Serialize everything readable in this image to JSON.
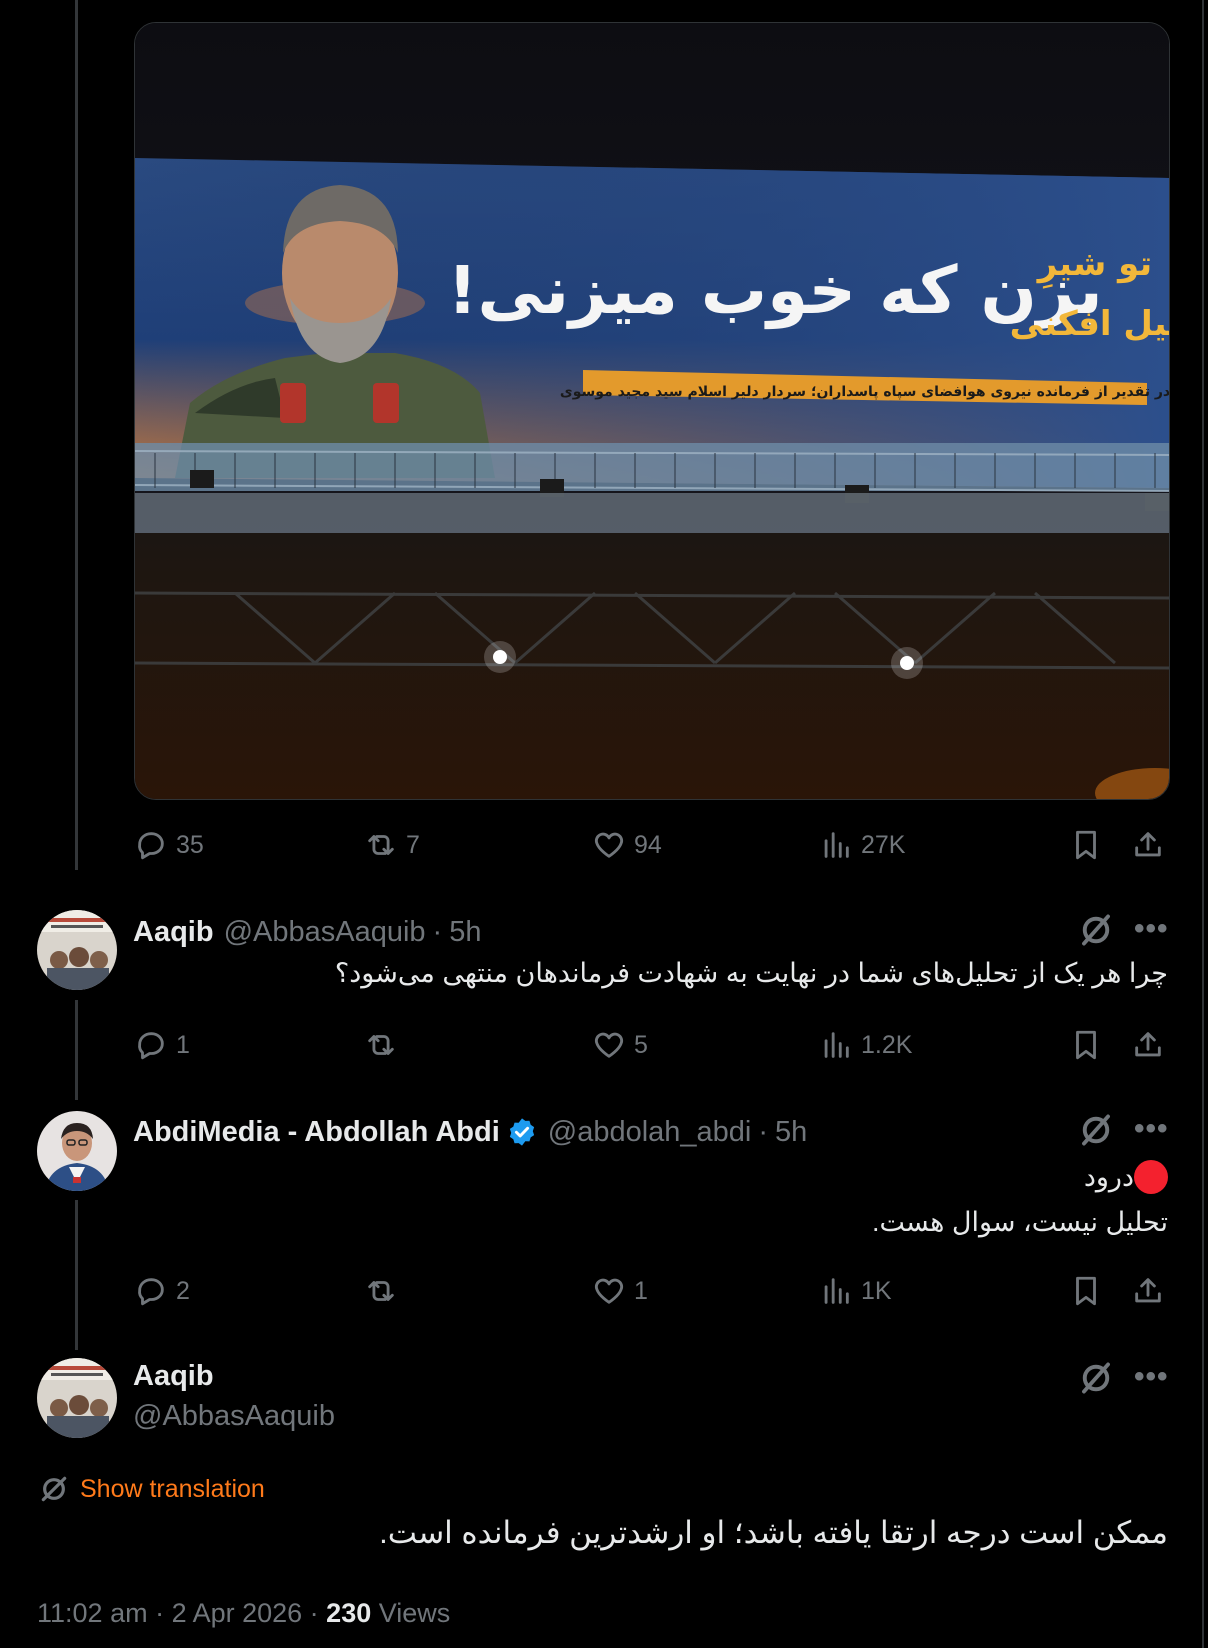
{
  "media": {
    "billboard_title": "بزن که خوب میزنی!",
    "billboard_side_1": "تو شیرِ",
    "billboard_side_2": "پیل افکنی",
    "billboard_banner": "در تقدیر از فرمانده نیروی هوافضای سپاه پاسداران؛ سردار دلیر اسلام سید مجید موسوی"
  },
  "main_stats": {
    "replies": "35",
    "reposts": "7",
    "likes": "94",
    "views": "27K"
  },
  "replies": [
    {
      "name": "Aaqib",
      "handle": "@AbbasAaquib",
      "time": "5h",
      "text": "چرا هر یک از تحلیل‌های شما در نهایت به شهادت فرماندهان منتهی می‌شود؟",
      "stats": {
        "replies": "1",
        "reposts": "",
        "likes": "5",
        "views": "1.2K"
      }
    },
    {
      "name": "AbdiMedia - Abdollah Abdi",
      "handle": "@abdolah_abdi",
      "time": "5h",
      "line1": "درود",
      "line2": "تحلیل نیست، سوال هست.",
      "stats": {
        "replies": "2",
        "reposts": "",
        "likes": "1",
        "views": "1K"
      }
    }
  ],
  "focused": {
    "name": "Aaqib",
    "handle": "@AbbasAaquib",
    "translate_label": "Show translation",
    "text": "ممکن است درجه ارتقا یافته باشد؛ او ارشدترین فرمانده است.",
    "timestamp": "11:02 am · 2 Apr 2026 · ",
    "views_count": "230",
    "views_label": " Views"
  },
  "separator": "·",
  "colors": {
    "background": "#000000",
    "text": "#e7e9ea",
    "muted": "#71767b",
    "accent_translate": "#ff7a1a",
    "verified": "#1d9bf0",
    "red_dot": "#f4212e"
  },
  "icons": [
    "reply-icon",
    "repost-icon",
    "like-icon",
    "views-icon",
    "bookmark-icon",
    "share-icon",
    "grok-icon",
    "more-icon",
    "verified-badge-icon",
    "translate-icon"
  ]
}
